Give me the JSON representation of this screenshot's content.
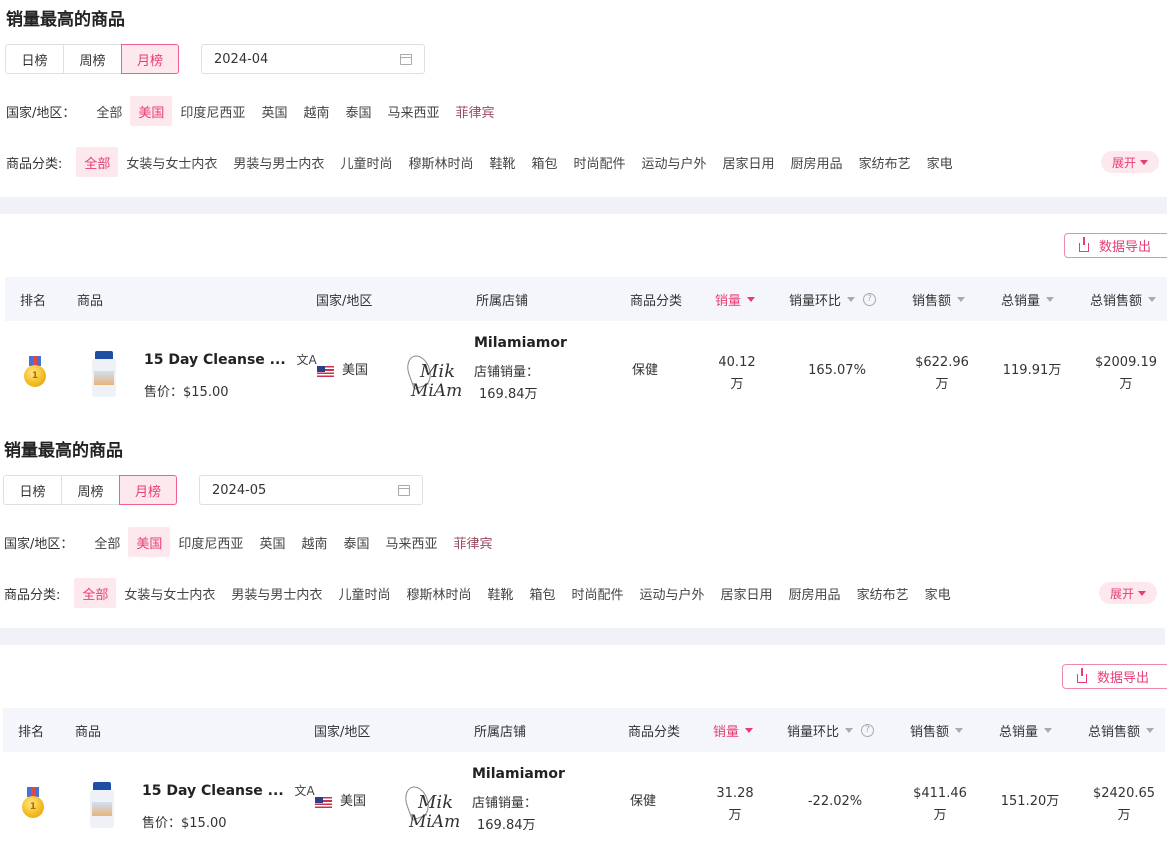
{
  "panels": [
    {
      "title": "销量最高的商品",
      "period_tabs": [
        "日榜",
        "周榜",
        "月榜"
      ],
      "active_period": "月榜",
      "date": "2024-04",
      "country_label": "国家/地区：",
      "countries": [
        "全部",
        "美国",
        "印度尼西亚",
        "英国",
        "越南",
        "泰国",
        "马来西亚",
        "菲律宾"
      ],
      "active_country": "美国",
      "category_label": "商品分类:",
      "categories": [
        "全部",
        "女装与女士内衣",
        "男装与男士内衣",
        "儿童时尚",
        "穆斯林时尚",
        "鞋靴",
        "箱包",
        "时尚配件",
        "运动与户外",
        "居家日用",
        "厨房用品",
        "家纺布艺",
        "家电"
      ],
      "active_category": "全部",
      "expand_label": "展开",
      "export_label": "数据导出",
      "columns": [
        "排名",
        "商品",
        "国家/地区",
        "所属店铺",
        "商品分类",
        "销量",
        "销量环比",
        "销售额",
        "总销量",
        "总销售额"
      ],
      "row": {
        "medal_number": "1",
        "product_name": "15 Day Cleanse ...",
        "translate_icon": "文A",
        "price": "售价：$15.00",
        "country": "美国",
        "shop_name": "Milamiamor",
        "shop_logo_line1": "Mik",
        "shop_logo_line2": "MiAm",
        "shop_sales_label": "店铺销量：",
        "shop_sales_value": "169.84万",
        "category": "保健",
        "sales_line1": "40.12",
        "sales_line2": "万",
        "sales_change": "165.07%",
        "revenue_line1": "$622.96",
        "revenue_line2": "万",
        "total_sales": "119.91万",
        "total_revenue_line1": "$2009.19",
        "total_revenue_line2": "万"
      }
    },
    {
      "title": "销量最高的商品",
      "period_tabs": [
        "日榜",
        "周榜",
        "月榜"
      ],
      "active_period": "月榜",
      "date": "2024-05",
      "country_label": "国家/地区：",
      "countries": [
        "全部",
        "美国",
        "印度尼西亚",
        "英国",
        "越南",
        "泰国",
        "马来西亚",
        "菲律宾"
      ],
      "active_country": "美国",
      "category_label": "商品分类:",
      "categories": [
        "全部",
        "女装与女士内衣",
        "男装与男士内衣",
        "儿童时尚",
        "穆斯林时尚",
        "鞋靴",
        "箱包",
        "时尚配件",
        "运动与户外",
        "居家日用",
        "厨房用品",
        "家纺布艺",
        "家电"
      ],
      "active_category": "全部",
      "expand_label": "展开",
      "export_label": "数据导出",
      "columns": [
        "排名",
        "商品",
        "国家/地区",
        "所属店铺",
        "商品分类",
        "销量",
        "销量环比",
        "销售额",
        "总销量",
        "总销售额"
      ],
      "row": {
        "medal_number": "1",
        "product_name": "15 Day Cleanse ...",
        "translate_icon": "文A",
        "price": "售价：$15.00",
        "country": "美国",
        "shop_name": "Milamiamor",
        "shop_logo_line1": "Mik",
        "shop_logo_line2": "MiAm",
        "shop_sales_label": "店铺销量：",
        "shop_sales_value": "169.84万",
        "category": "保健",
        "sales_line1": "31.28",
        "sales_line2": "万",
        "sales_change": "-22.02%",
        "revenue_line1": "$411.46",
        "revenue_line2": "万",
        "total_sales": "151.20万",
        "total_revenue_line1": "$2420.65",
        "total_revenue_line2": "万"
      }
    }
  ],
  "colors": {
    "accent": "#e83d73",
    "accent_bg": "#fde8ee",
    "header_bg": "#f4f6fb",
    "divider_bg": "#f0f2f8"
  }
}
